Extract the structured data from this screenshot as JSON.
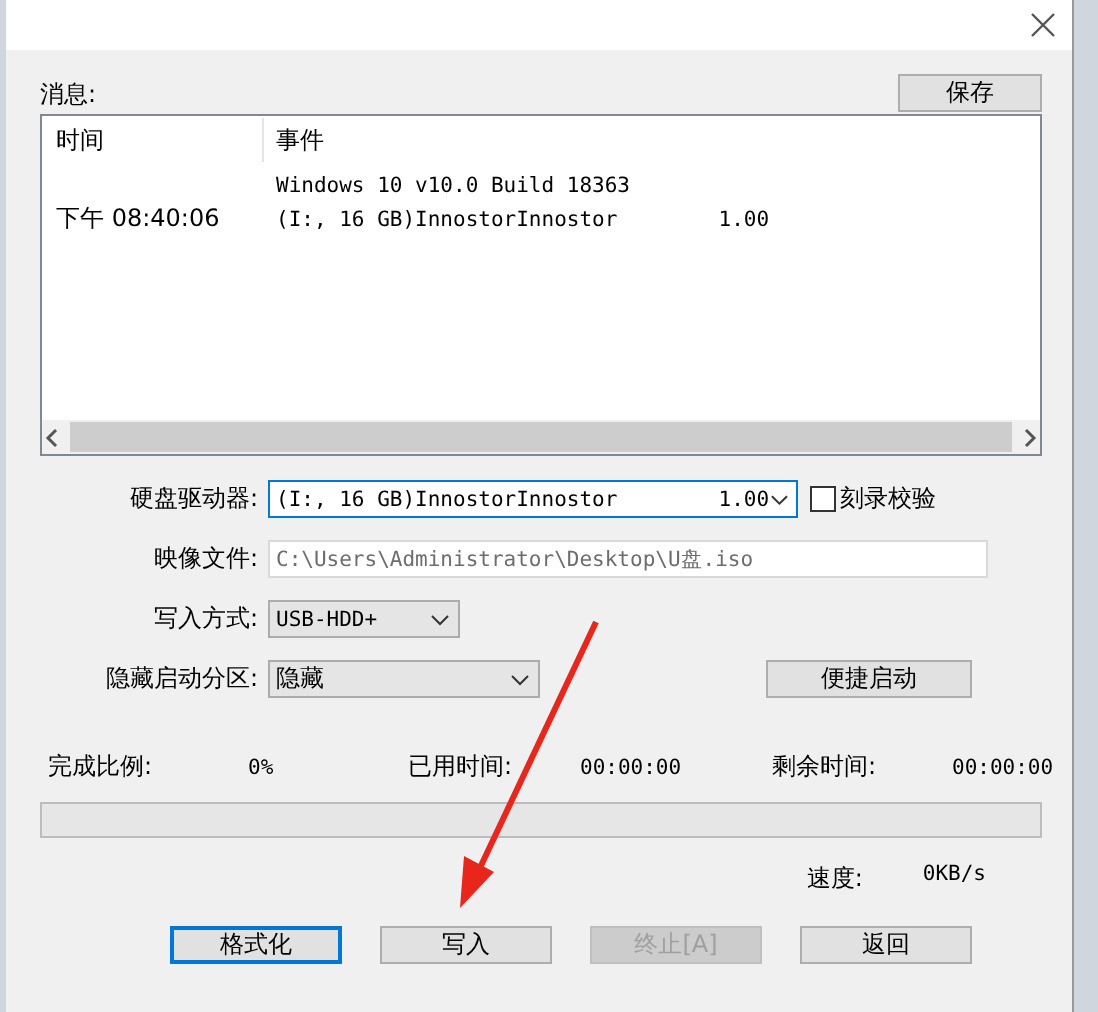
{
  "log": {
    "label": "消息:",
    "save_button": "保存",
    "columns": [
      "时间",
      "事件"
    ],
    "rows": [
      {
        "event": "Windows 10 v10.0 Build 18363"
      },
      {
        "time": "下午 08:40:06",
        "event": "(I:, 16 GB)InnostorInnostor        1.00"
      }
    ]
  },
  "form": {
    "drive": {
      "label": "硬盘驱动器:",
      "value": "(I:, 16 GB)InnostorInnostor        1.00",
      "verify_label": "刻录校验",
      "verify_checked": false
    },
    "image_file": {
      "label": "映像文件:",
      "value": "C:\\Users\\Administrator\\Desktop\\U盘.iso"
    },
    "write_mode": {
      "label": "写入方式:",
      "value": "USB-HDD+"
    },
    "hidden_partition": {
      "label": "隐藏启动分区:",
      "value": "隐藏",
      "button": "便捷启动"
    }
  },
  "progress": {
    "done_label": "完成比例:",
    "done_value": "0%",
    "elapsed_label": "已用时间:",
    "elapsed_value": "00:00:00",
    "remaining_label": "剩余时间:",
    "remaining_value": "00:00:00",
    "level": 0,
    "speed_label": "速度:",
    "speed_value": "0KB/s"
  },
  "buttons": [
    {
      "label": "格式化",
      "default": true,
      "disabled": false
    },
    {
      "label": "写入",
      "default": false,
      "disabled": false
    },
    {
      "label": "终止[A]",
      "default": false,
      "disabled": true
    },
    {
      "label": "返回",
      "default": false,
      "disabled": false
    }
  ]
}
